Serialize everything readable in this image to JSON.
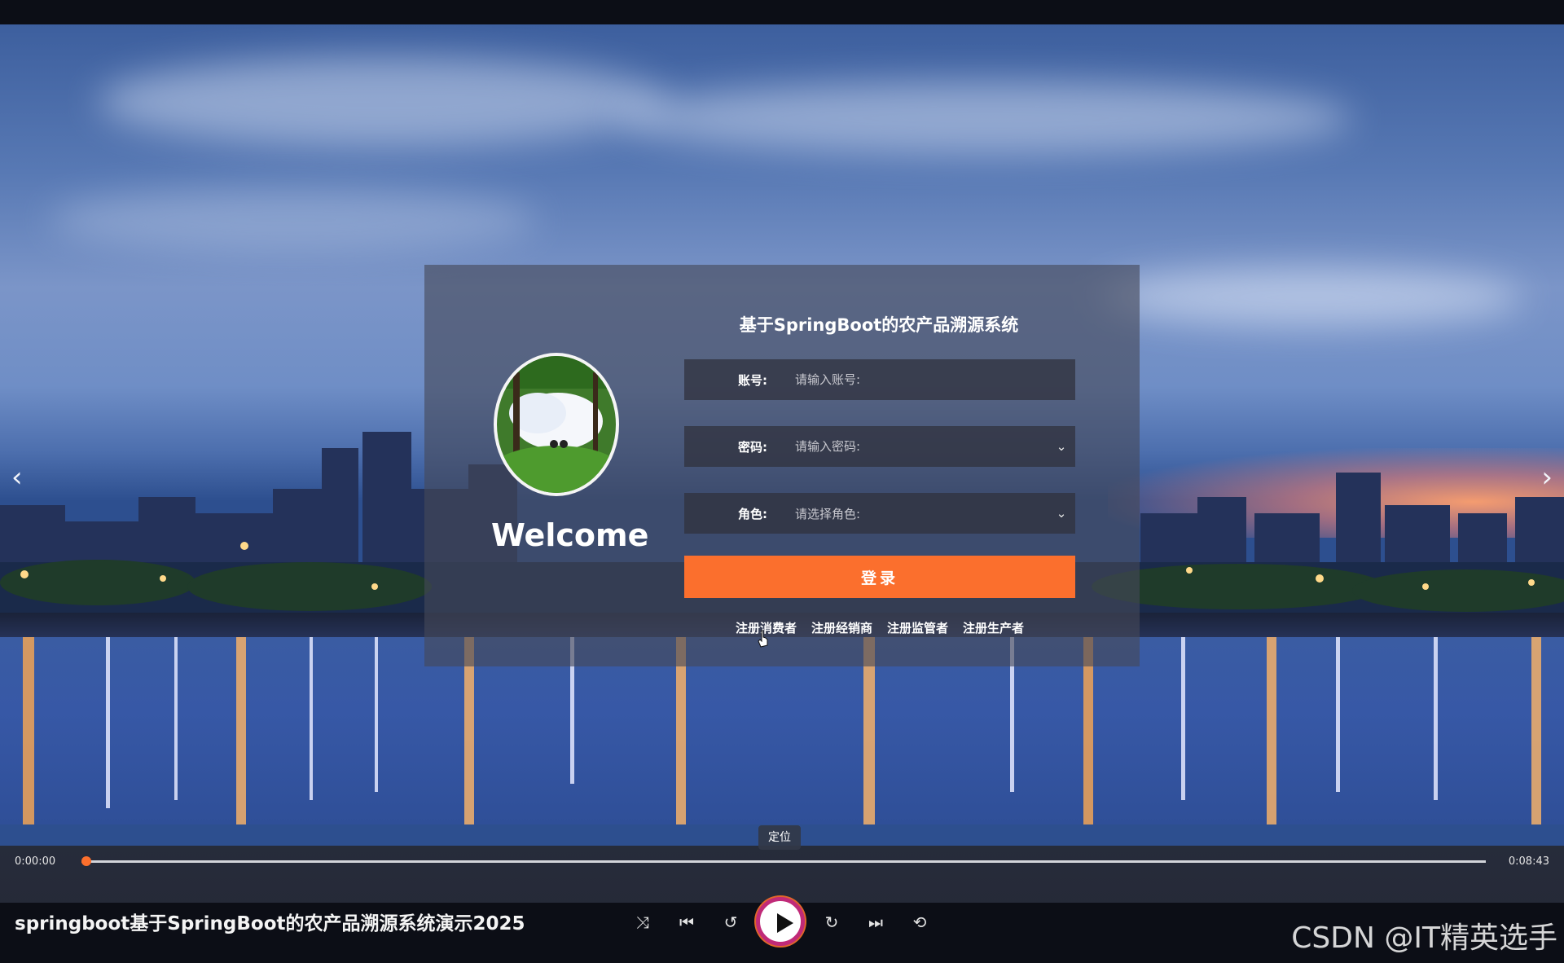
{
  "login": {
    "system_title": "基于SpringBoot的农产品溯源系统",
    "welcome": "Welcome",
    "account_label": "账号:",
    "account_placeholder": "请输入账号:",
    "password_label": "密码:",
    "password_placeholder": "请输入密码:",
    "role_label": "角色:",
    "role_placeholder": "请选择角色:",
    "login_button": "登录",
    "register_links": [
      "注册消费者",
      "注册经销商",
      "注册监管者",
      "注册生产者"
    ]
  },
  "player": {
    "tooltip": "定位",
    "current_time": "0:00:00",
    "total_time": "0:08:43",
    "progress": 0,
    "video_title": "springboot基于SpringBoot的农产品溯源系统演示2025",
    "watermark": "CSDN @IT精英选手",
    "controls": [
      "shuffle-icon",
      "previous-icon",
      "rewind-icon",
      "play-icon",
      "forward-icon",
      "next-icon",
      "loop-off-icon"
    ]
  },
  "accent_color": "#fb6f2d"
}
